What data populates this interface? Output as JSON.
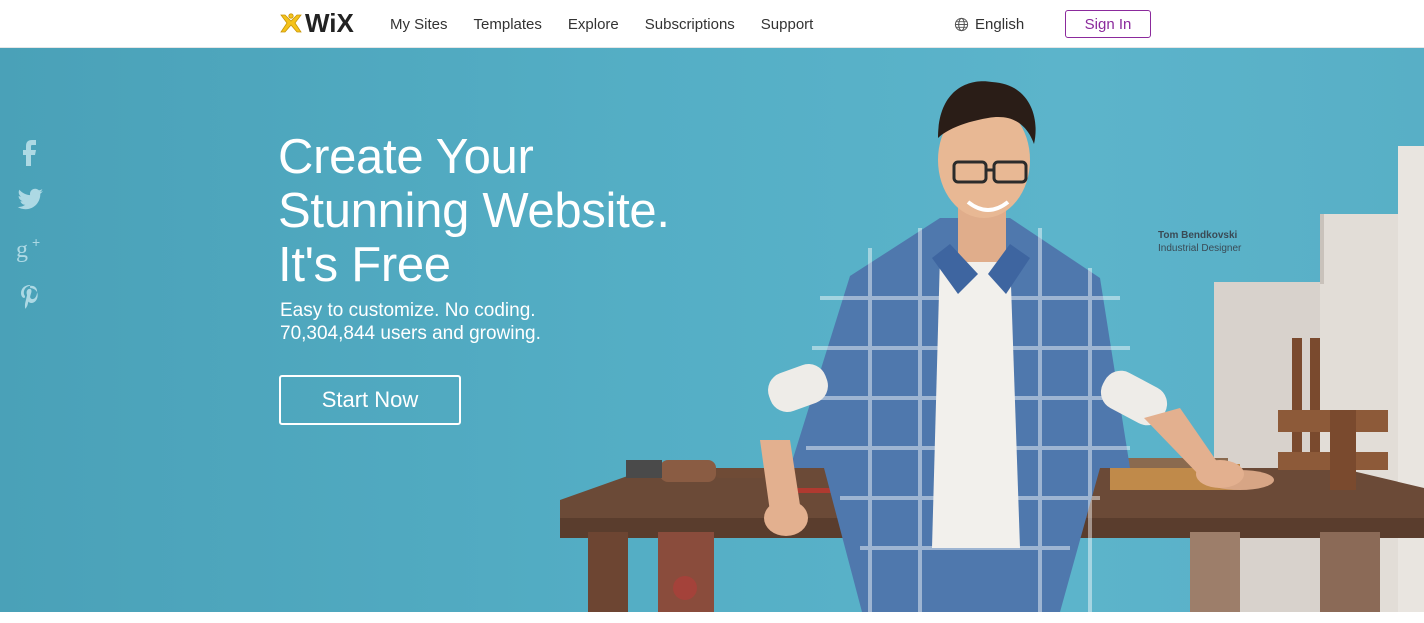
{
  "brand": {
    "logo_text": "WiX"
  },
  "nav": {
    "items": [
      "My Sites",
      "Templates",
      "Explore",
      "Subscriptions",
      "Support"
    ]
  },
  "language": {
    "label": "English",
    "icon": "globe-icon"
  },
  "signin": {
    "label": "Sign In"
  },
  "social": [
    {
      "icon": "facebook-icon"
    },
    {
      "icon": "twitter-icon"
    },
    {
      "icon": "google-plus-icon"
    },
    {
      "icon": "pinterest-icon"
    }
  ],
  "hero": {
    "headline": [
      "Create Your",
      "Stunning Website.",
      "It's Free"
    ],
    "subline": [
      "Easy to customize. No coding.",
      "70,304,844 users and growing."
    ],
    "cta_label": "Start Now",
    "caption": {
      "name": "Tom Bendkovski",
      "role": "Industrial Designer"
    }
  },
  "colors": {
    "hero_bg": "#54aec5",
    "accent": "#8b2a9c",
    "logo_yellow": "#f5c31b"
  }
}
